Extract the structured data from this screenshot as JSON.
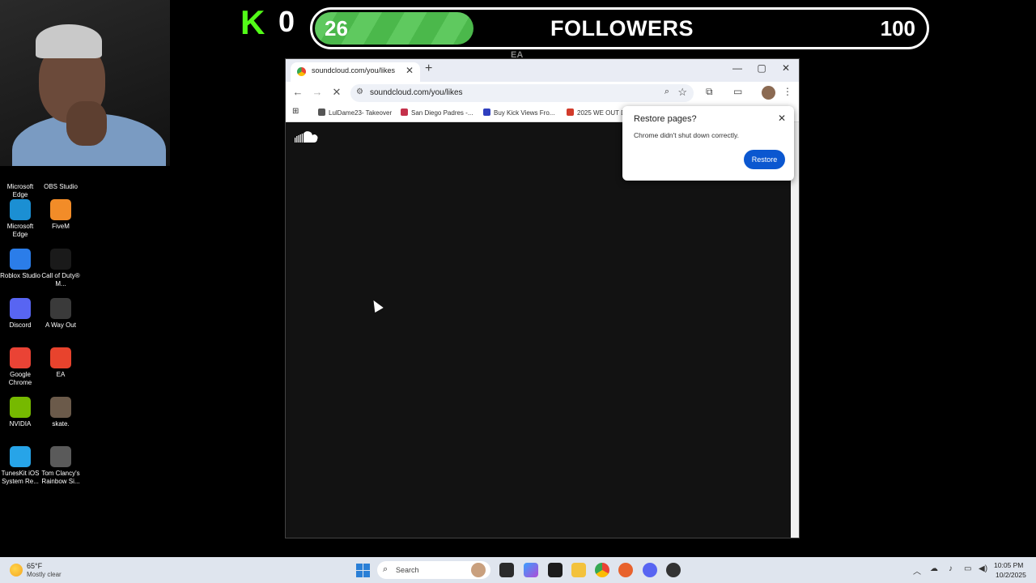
{
  "overlay": {
    "kick_count": "0",
    "goal_current": "26",
    "goal_label": "FOLLOWERS",
    "goal_target": "100",
    "goal_progress": 0.26,
    "ea_ghost": "EA"
  },
  "desktop_icons": [
    {
      "label": "Microsoft Edge",
      "icon": "edge-icon",
      "color": "#1b8fd3"
    },
    {
      "label": "OBS Studio",
      "icon": "obs-icon",
      "color": "#302e31"
    },
    {
      "label": "Microsoft Edge",
      "icon": "edge-icon",
      "color": "#1b8fd3"
    },
    {
      "label": "FiveM",
      "icon": "fivem-icon",
      "color": "#f28c28"
    },
    {
      "label": "Roblox Studio",
      "icon": "roblox-studio-icon",
      "color": "#2b7de9"
    },
    {
      "label": "Call of Duty® M...",
      "icon": "cod-icon",
      "color": "#1a1a1a"
    },
    {
      "label": "Discord",
      "icon": "discord-icon",
      "color": "#5865f2"
    },
    {
      "label": "A Way Out",
      "icon": "a-way-out-icon",
      "color": "#3a3a3a"
    },
    {
      "label": "Google Chrome",
      "icon": "chrome-icon",
      "color": "#ea4335"
    },
    {
      "label": "EA",
      "icon": "ea-icon",
      "color": "#e8432d"
    },
    {
      "label": "NVIDIA",
      "icon": "nvidia-icon",
      "color": "#76b900"
    },
    {
      "label": "skate.",
      "icon": "skate-icon",
      "color": "#6b5a4a"
    },
    {
      "label": "TunesKit iOS System Re...",
      "icon": "tuneskit-icon",
      "color": "#27a4e8"
    },
    {
      "label": "Tom Clancy's Rainbow Si...",
      "icon": "rainbow-six-icon",
      "color": "#5a5a5a"
    }
  ],
  "browser": {
    "tab_title": "soundcloud.com/you/likes",
    "url": "soundcloud.com/you/likes",
    "bookmarks": [
      {
        "label": "LulDame23- Takeover",
        "icon_color": "#555555"
      },
      {
        "label": "San Diego Padres -...",
        "icon_color": "#c4314b"
      },
      {
        "label": "Buy Kick Views Fro...",
        "icon_color": "#2f3fbf"
      },
      {
        "label": "2025 WE OUT D",
        "icon_color": "#d23b2b"
      }
    ],
    "page_bg": "#121212"
  },
  "restore_popup": {
    "title": "Restore pages?",
    "message": "Chrome didn't shut down correctly.",
    "button": "Restore"
  },
  "taskbar": {
    "temperature": "65°F",
    "condition": "Mostly clear",
    "search_placeholder": "Search",
    "time": "10:05 PM",
    "date": "10/2/2025"
  }
}
